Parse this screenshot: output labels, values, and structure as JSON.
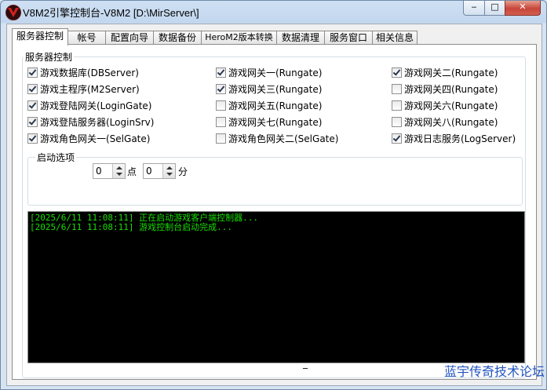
{
  "window": {
    "title": "V8M2引擎控制台-V8M2 [D:\\MirServer\\]",
    "minimize_glyph": "‒",
    "maximize_glyph": "□",
    "close_glyph": "✕"
  },
  "tabs": [
    {
      "label": "服务器控制",
      "active": true
    },
    {
      "label": "帐号"
    },
    {
      "label": "配置向导"
    },
    {
      "label": "数据备份"
    },
    {
      "label": "HeroM2版本转换"
    },
    {
      "label": "数据清理"
    },
    {
      "label": "服务窗口"
    },
    {
      "label": "相关信息"
    }
  ],
  "server_group": {
    "title": "服务器控制",
    "checkboxes": [
      {
        "label": "游戏数据库(DBServer)",
        "checked": true
      },
      {
        "label": "游戏网关一(Rungate)",
        "checked": true
      },
      {
        "label": "游戏网关二(Rungate)",
        "checked": true
      },
      {
        "label": "游戏主程序(M2Server)",
        "checked": true
      },
      {
        "label": "游戏网关三(Rungate)",
        "checked": true
      },
      {
        "label": "游戏网关四(Rungate)",
        "checked": false
      },
      {
        "label": "游戏登陆网关(LoginGate)",
        "checked": true
      },
      {
        "label": "游戏网关五(Rungate)",
        "checked": false
      },
      {
        "label": "游戏网关六(Rungate)",
        "checked": false
      },
      {
        "label": "游戏登陆服务器(LoginSrv)",
        "checked": true
      },
      {
        "label": "游戏网关七(Rungate)",
        "checked": false
      },
      {
        "label": "游戏网关八(Rungate)",
        "checked": false
      },
      {
        "label": "游戏角色网关一(SelGate)",
        "checked": true
      },
      {
        "label": "游戏角色网关二(SelGate)",
        "checked": false
      },
      {
        "label": "游戏日志服务(LogServer)",
        "checked": true
      }
    ]
  },
  "startup": {
    "title": "启动选项",
    "hour_value": "0",
    "hour_unit": "点",
    "minute_value": "0",
    "minute_unit": "分"
  },
  "log": {
    "lines": [
      "[2025/6/11 11:08:11] 正在启动游戏客户端控制器...",
      "[2025/6/11 11:08:11] 游戏控制台启动完成..."
    ],
    "text_color": "#17e000",
    "background": "#000000"
  },
  "status": {
    "text": "_"
  },
  "watermark": {
    "text": "蓝宇传奇技术论坛"
  }
}
